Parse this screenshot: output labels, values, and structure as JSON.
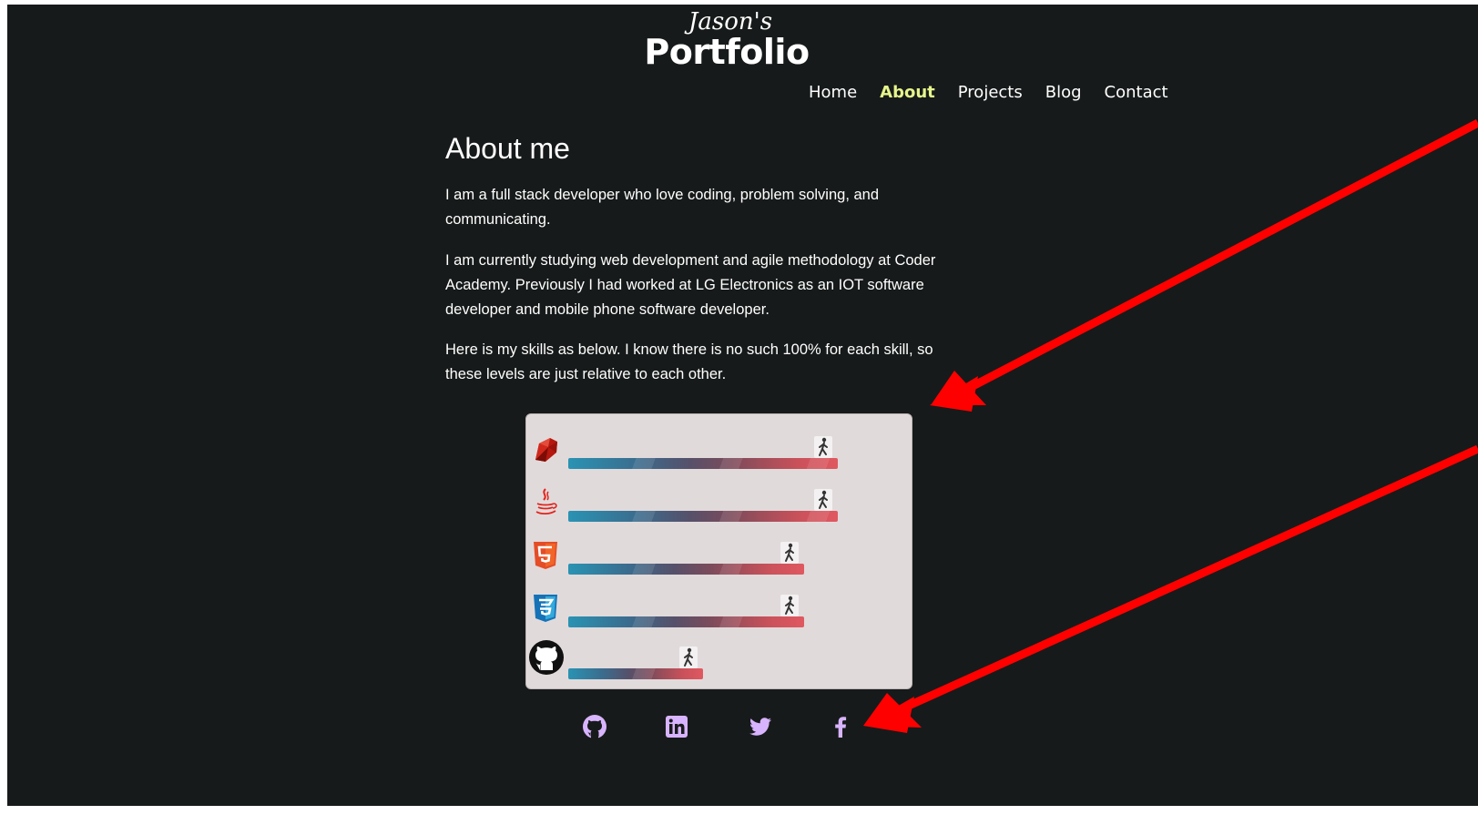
{
  "logo": {
    "script": "Jason's",
    "main": "Portfolio"
  },
  "nav": {
    "items": [
      {
        "label": "Home",
        "active": false
      },
      {
        "label": "About",
        "active": true
      },
      {
        "label": "Projects",
        "active": false
      },
      {
        "label": "Blog",
        "active": false
      },
      {
        "label": "Contact",
        "active": false
      }
    ]
  },
  "about": {
    "title": "About me",
    "paragraphs": [
      "I am a full stack developer who love coding, problem solving, and communicating.",
      "I am currently studying web development and agile methodology at Coder Academy. Previously I had worked at LG Electronics as an IOT software developer and mobile phone software developer.",
      "Here is my skills as below. I know there is no such 100% for each skill, so these levels are just relative to each other."
    ]
  },
  "skills": [
    {
      "icon": "ruby-icon",
      "level": 100
    },
    {
      "icon": "java-icon",
      "level": 100
    },
    {
      "icon": "html5-icon",
      "level": 87.5
    },
    {
      "icon": "css3-icon",
      "level": 87.5
    },
    {
      "icon": "github-icon",
      "level": 50
    }
  ],
  "social": [
    {
      "icon": "github-icon"
    },
    {
      "icon": "linkedin-icon"
    },
    {
      "icon": "twitter-icon"
    },
    {
      "icon": "facebook-icon"
    }
  ],
  "colors": {
    "background": "#171a1a",
    "nav_active": "#e6f58c",
    "panel": "#e1dadb",
    "social_icon": "#d8b4fe",
    "annotation_arrow": "#ff0000"
  }
}
